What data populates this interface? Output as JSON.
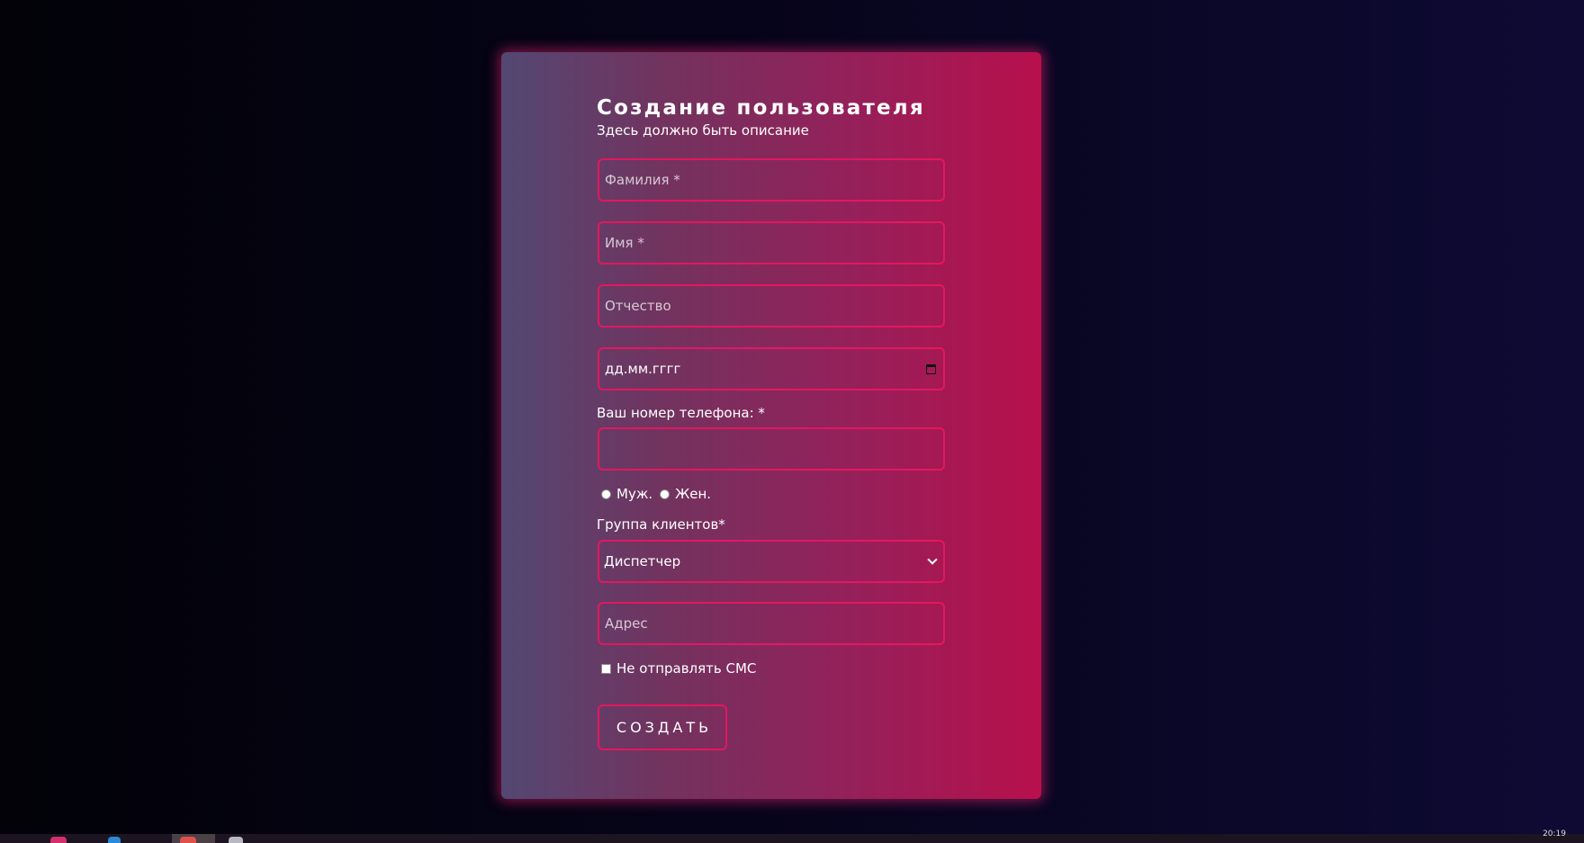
{
  "form": {
    "title": "Создание пользователя",
    "subtitle": "Здесь должно быть описание",
    "last_name_placeholder": "Фамилия *",
    "first_name_placeholder": "Имя *",
    "patronymic_placeholder": "Отчество",
    "birthdate_placeholder": "дд.мм.гггг",
    "phone_label": "Ваш номер телефона: *",
    "phone_value": "",
    "gender_options": [
      "Муж.",
      "Жен."
    ],
    "client_group_label": "Группа клиентов*",
    "client_group_selected": "Диспетчер",
    "address_placeholder": "Адрес",
    "no_sms_label": "Не отправлять СМС",
    "no_sms_checked": false,
    "submit_label": "СОЗДАТЬ"
  },
  "theme": {
    "accent": "#e3175f",
    "card_gradient_start": "#524872",
    "card_gradient_end": "#b8104c",
    "background_start": "#020208",
    "background_end": "#0e0a34"
  },
  "icons": {
    "date_picker": "calendar-icon",
    "select": "chevron-down-icon"
  },
  "taskbar": {
    "clock": "20:19"
  }
}
